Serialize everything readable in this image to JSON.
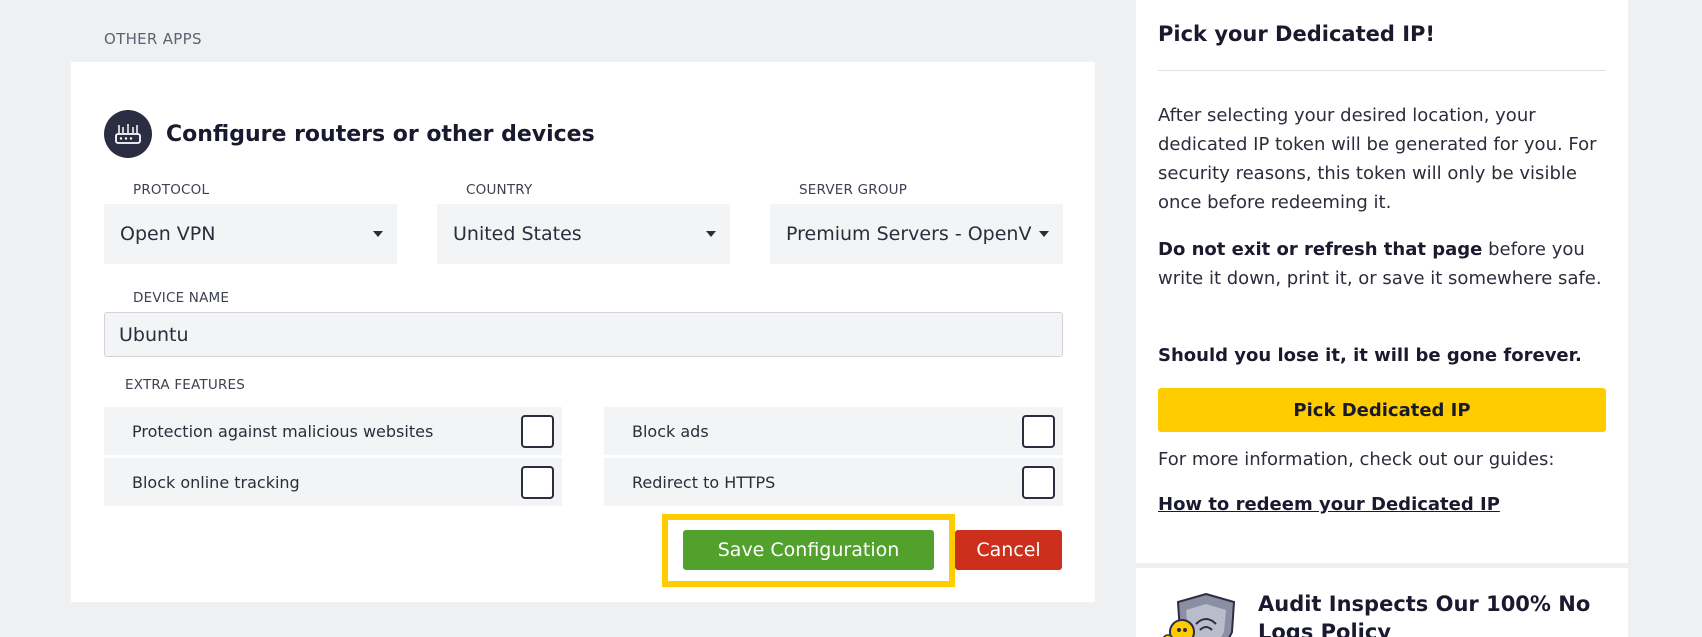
{
  "section": {
    "heading": "OTHER APPS"
  },
  "config": {
    "title": "Configure routers or other devices",
    "icon": "router-icon",
    "protocol": {
      "label": "PROTOCOL",
      "value": "Open VPN"
    },
    "country": {
      "label": "COUNTRY",
      "value": "United States"
    },
    "server_group": {
      "label": "SERVER GROUP",
      "value": "Premium Servers - OpenVPN"
    },
    "device": {
      "label": "DEVICE NAME",
      "value": "Ubuntu"
    },
    "extras": {
      "label": "EXTRA FEATURES",
      "items": [
        {
          "label": "Protection against malicious websites",
          "checked": false
        },
        {
          "label": "Block ads",
          "checked": false
        },
        {
          "label": "Block online tracking",
          "checked": false
        },
        {
          "label": "Redirect to HTTPS",
          "checked": false
        }
      ]
    },
    "save_label": "Save Configuration",
    "cancel_label": "Cancel"
  },
  "sidebar": {
    "title": "Pick your Dedicated IP!",
    "para1": "After selecting your desired location, your dedicated IP token will be generated for you. For security reasons, this token will only be visible once before redeeming it.",
    "para2_bold": "Do not exit or refresh that page",
    "para2_rest": " before you write it down, print it, or save it somewhere safe.",
    "para3": "Should you lose it, it will be gone forever.",
    "button_label": "Pick Dedicated IP",
    "guides_text": "For more information, check out our guides:",
    "guide_link": "How to redeem your Dedicated IP"
  },
  "audit": {
    "text_prefix": "Audit Inspects Our 100% ",
    "text_bold": "No Logs Policy",
    "icon": "shield-badge-icon"
  },
  "colors": {
    "accent_yellow": "#ffcc00",
    "save_green": "#52a12c",
    "cancel_red": "#cc2f1b",
    "dark": "#2b2d42"
  }
}
